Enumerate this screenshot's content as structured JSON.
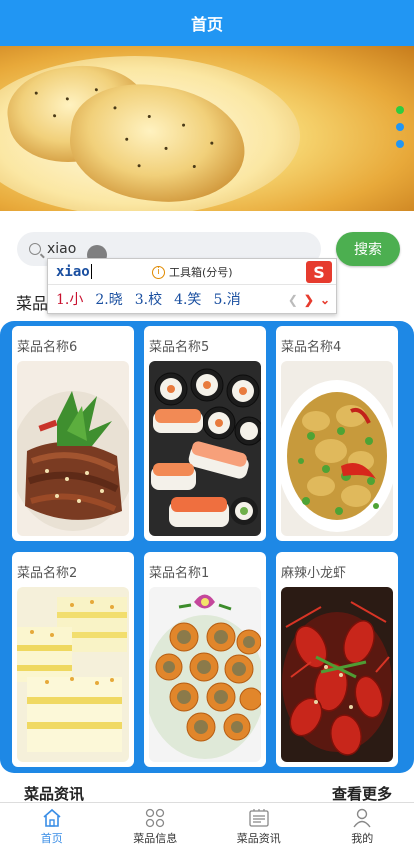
{
  "header": {
    "title": "首页"
  },
  "banner": {
    "indicator_colors": [
      "#2ecc40",
      "#2196f3",
      "#2196f3"
    ]
  },
  "search": {
    "value": "xiao",
    "button_label": "搜索"
  },
  "section": {
    "label": "菜品"
  },
  "ime": {
    "composition": "xiao",
    "toolbox_label": "工具箱(分号)",
    "candidates": [
      "1.小",
      "2.晓",
      "3.校",
      "4.笑",
      "5.消"
    ],
    "logo": "S"
  },
  "dishes": [
    {
      "name": "菜品名称6",
      "image": "sliced-beef-sesame"
    },
    {
      "name": "菜品名称5",
      "image": "sushi-rolls"
    },
    {
      "name": "菜品名称4",
      "image": "stir-fry-chili"
    },
    {
      "name": "菜品名称2",
      "image": "layered-cake"
    },
    {
      "name": "菜品名称1",
      "image": "rice-rolls"
    },
    {
      "name": "麻辣小龙虾",
      "image": "spicy-crayfish"
    }
  ],
  "news": {
    "title": "菜品资讯",
    "more_label": "查看更多"
  },
  "tabs": [
    {
      "label": "首页",
      "icon": "home-icon",
      "active": true
    },
    {
      "label": "菜品信息",
      "icon": "grid-icon",
      "active": false
    },
    {
      "label": "菜品资讯",
      "icon": "news-icon",
      "active": false
    },
    {
      "label": "我的",
      "icon": "user-icon",
      "active": false
    }
  ],
  "colors": {
    "primary": "#2196f3",
    "search_button": "#4caf50",
    "grid_background": "#1e88e5",
    "tab_active": "#3a8ee6"
  }
}
